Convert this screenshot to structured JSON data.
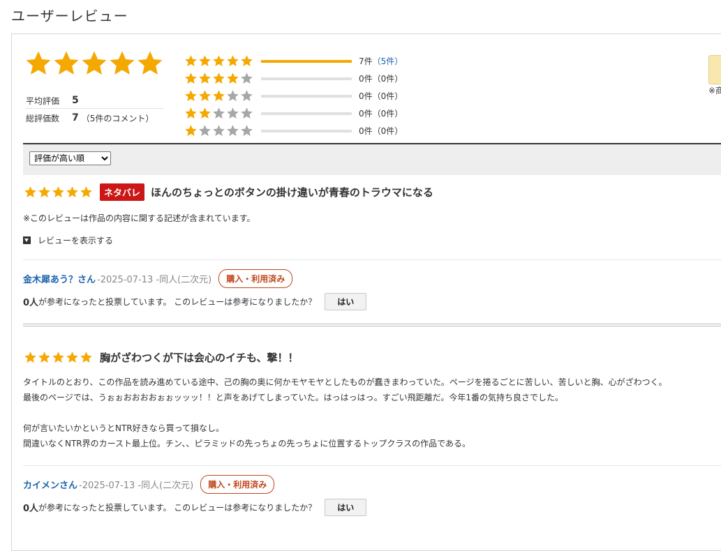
{
  "page_title": "ユーザーレビュー",
  "summary": {
    "average_label": "平均評価",
    "average_value": "5",
    "total_label": "総評価数",
    "total_value": "7",
    "total_sub": "（5件のコメント）",
    "distribution": [
      {
        "stars": 5,
        "count": "7件",
        "comments": "（5件）",
        "fill": 1.0
      },
      {
        "stars": 4,
        "count": "0件",
        "comments": "（0件）",
        "fill": 0
      },
      {
        "stars": 3,
        "count": "0件",
        "comments": "（0件）",
        "fill": 0
      },
      {
        "stars": 2,
        "count": "0件",
        "comments": "（0件）",
        "fill": 0
      },
      {
        "stars": 1,
        "count": "0件",
        "comments": "（0件）",
        "fill": 0
      }
    ],
    "side_note": "※商"
  },
  "sort": {
    "selected": "評価が高い順"
  },
  "reviews": [
    {
      "rating": 5,
      "spoiler": "ネタバレ",
      "title": "ほんのちょっとのボタンの掛け違いが青春のトラウマになる",
      "note": "※このレビューは作品の内容に関する記述が含まれています。",
      "toggle": "レビューを表示する",
      "reviewer": "金木犀あう？さん",
      "date": "-2025-07-13 -同人(二次元)",
      "badge": "購入・利用済み",
      "helpful_num": "0人",
      "helpful_text": "が参考になったと投票しています。 このレビューは参考になりましたか？",
      "yes": "はい"
    },
    {
      "rating": 5,
      "title": "胸がざわつくが下は会心のイチも、撃！！",
      "body": [
        "タイトルのとおり、この作品を読み進めている途中、己の胸の奥に何かモヤモヤとしたものが蠢きまわっていた。ページを捲るごとに苦しい、苦しいと胸、心がざわつく。",
        "最後のページでは、うぉぉおおおおぉぉッッッ！！と声をあげてしまっていた。はっはっはっ。すごい飛距離だ。今年1番の気持ち良さでした。",
        "",
        "何が言いたいかというとNTR好きなら買って損なし。",
        "間違いなくNTR界のカースト最上位。チン、、ピラミッドの先っちょの先っちょに位置するトップクラスの作品である。"
      ],
      "reviewer": "カイメンさん",
      "date": "-2025-07-13 -同人(二次元)",
      "badge": "購入・利用済み",
      "helpful_num": "0人",
      "helpful_text": "が参考になったと投票しています。 このレビューは参考になりましたか？",
      "yes": "はい"
    }
  ],
  "colors": {
    "star": "#f5a800",
    "star_empty": "#a7a7a7",
    "link": "#1a63ad",
    "spoiler": "#cc1717",
    "badge": "#c0461b"
  }
}
